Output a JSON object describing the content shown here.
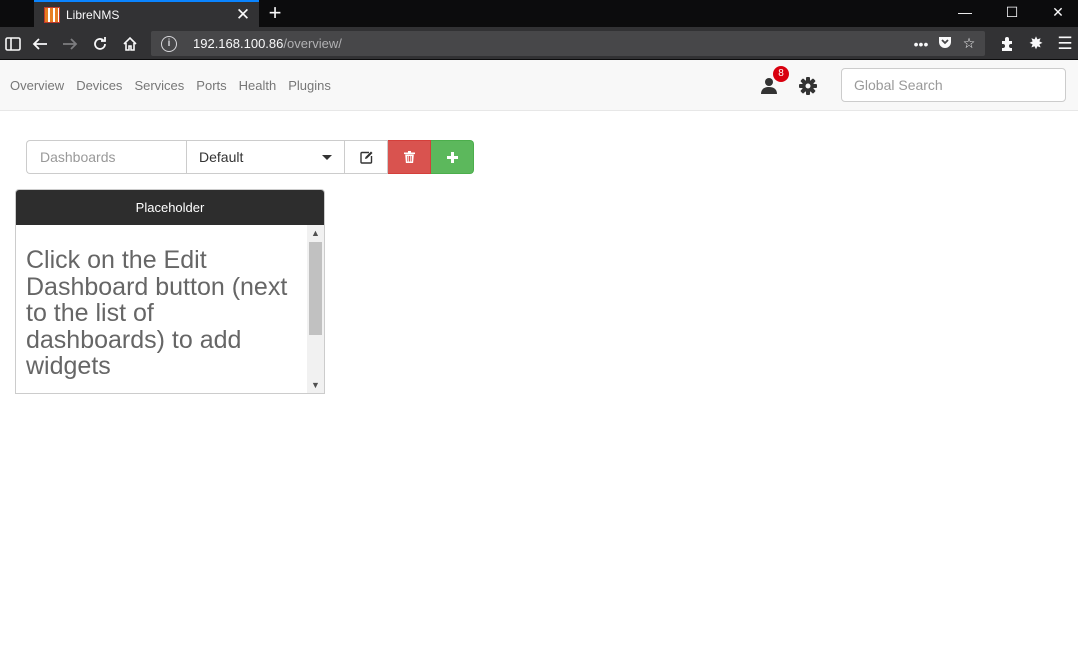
{
  "browser": {
    "tab_title": "LibreNMS",
    "url_host": "192.168.100.86",
    "url_path": "/overview/"
  },
  "nav": {
    "items": [
      "Overview",
      "Devices",
      "Services",
      "Ports",
      "Health",
      "Plugins"
    ],
    "notification_count": "8",
    "search_placeholder": "Global Search"
  },
  "toolbar": {
    "dashboards_label": "Dashboards",
    "selected_dashboard": "Default"
  },
  "widget": {
    "title": "Placeholder",
    "body": "Click on the Edit Dashboard button (next to the list of dashboards) to add widgets"
  },
  "colors": {
    "delete": "#d9534f",
    "add": "#5cb85c",
    "widget_header": "#2d2d2d",
    "badge": "#d9000f"
  }
}
